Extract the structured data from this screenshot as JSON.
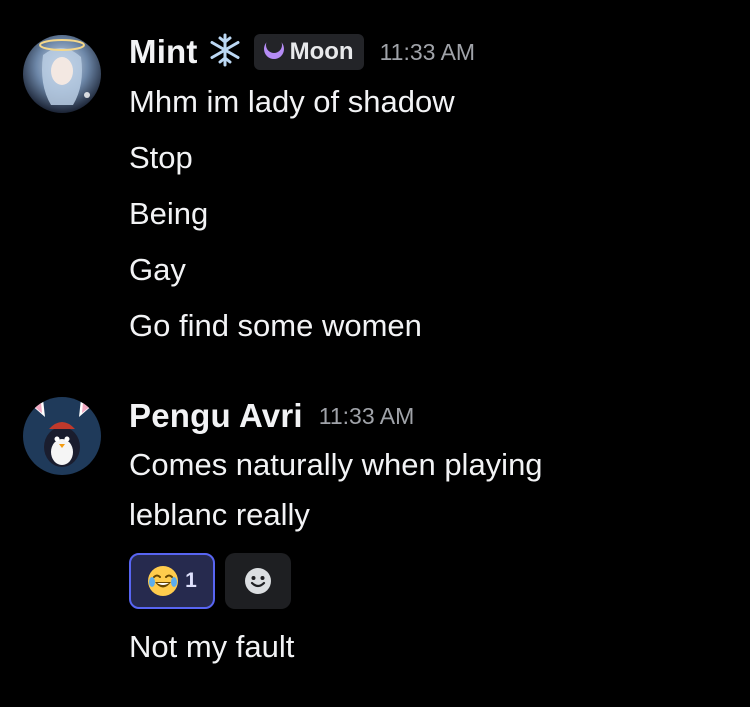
{
  "messages": [
    {
      "username": "Mint",
      "name_icon": "snowflake-icon",
      "tag": {
        "icon": "crescent-moon-icon",
        "label": "Moon"
      },
      "timestamp": "11:33 AM",
      "lines": [
        "Mhm im lady of shadow",
        "Stop",
        "Being",
        "Gay",
        "Go find some women"
      ]
    },
    {
      "username": "Pengu Avri",
      "timestamp": "11:33 AM",
      "lines": [
        "Comes naturally when playing",
        "leblanc really"
      ],
      "reactions": [
        {
          "emoji": "😂",
          "icon": "joy-emoji-icon",
          "count": "1",
          "active": true
        },
        {
          "icon": "add-reaction-icon"
        }
      ],
      "after_reactions": [
        "Not my fault"
      ]
    }
  ],
  "colors": {
    "background": "#000000",
    "text": "#f2f3f5",
    "timestamp": "#a0a3a9",
    "tag_bg": "#232428",
    "reaction_active_bg": "#262a4e",
    "reaction_active_border": "#5865f2",
    "add_reaction_bg": "#1e1f22"
  }
}
